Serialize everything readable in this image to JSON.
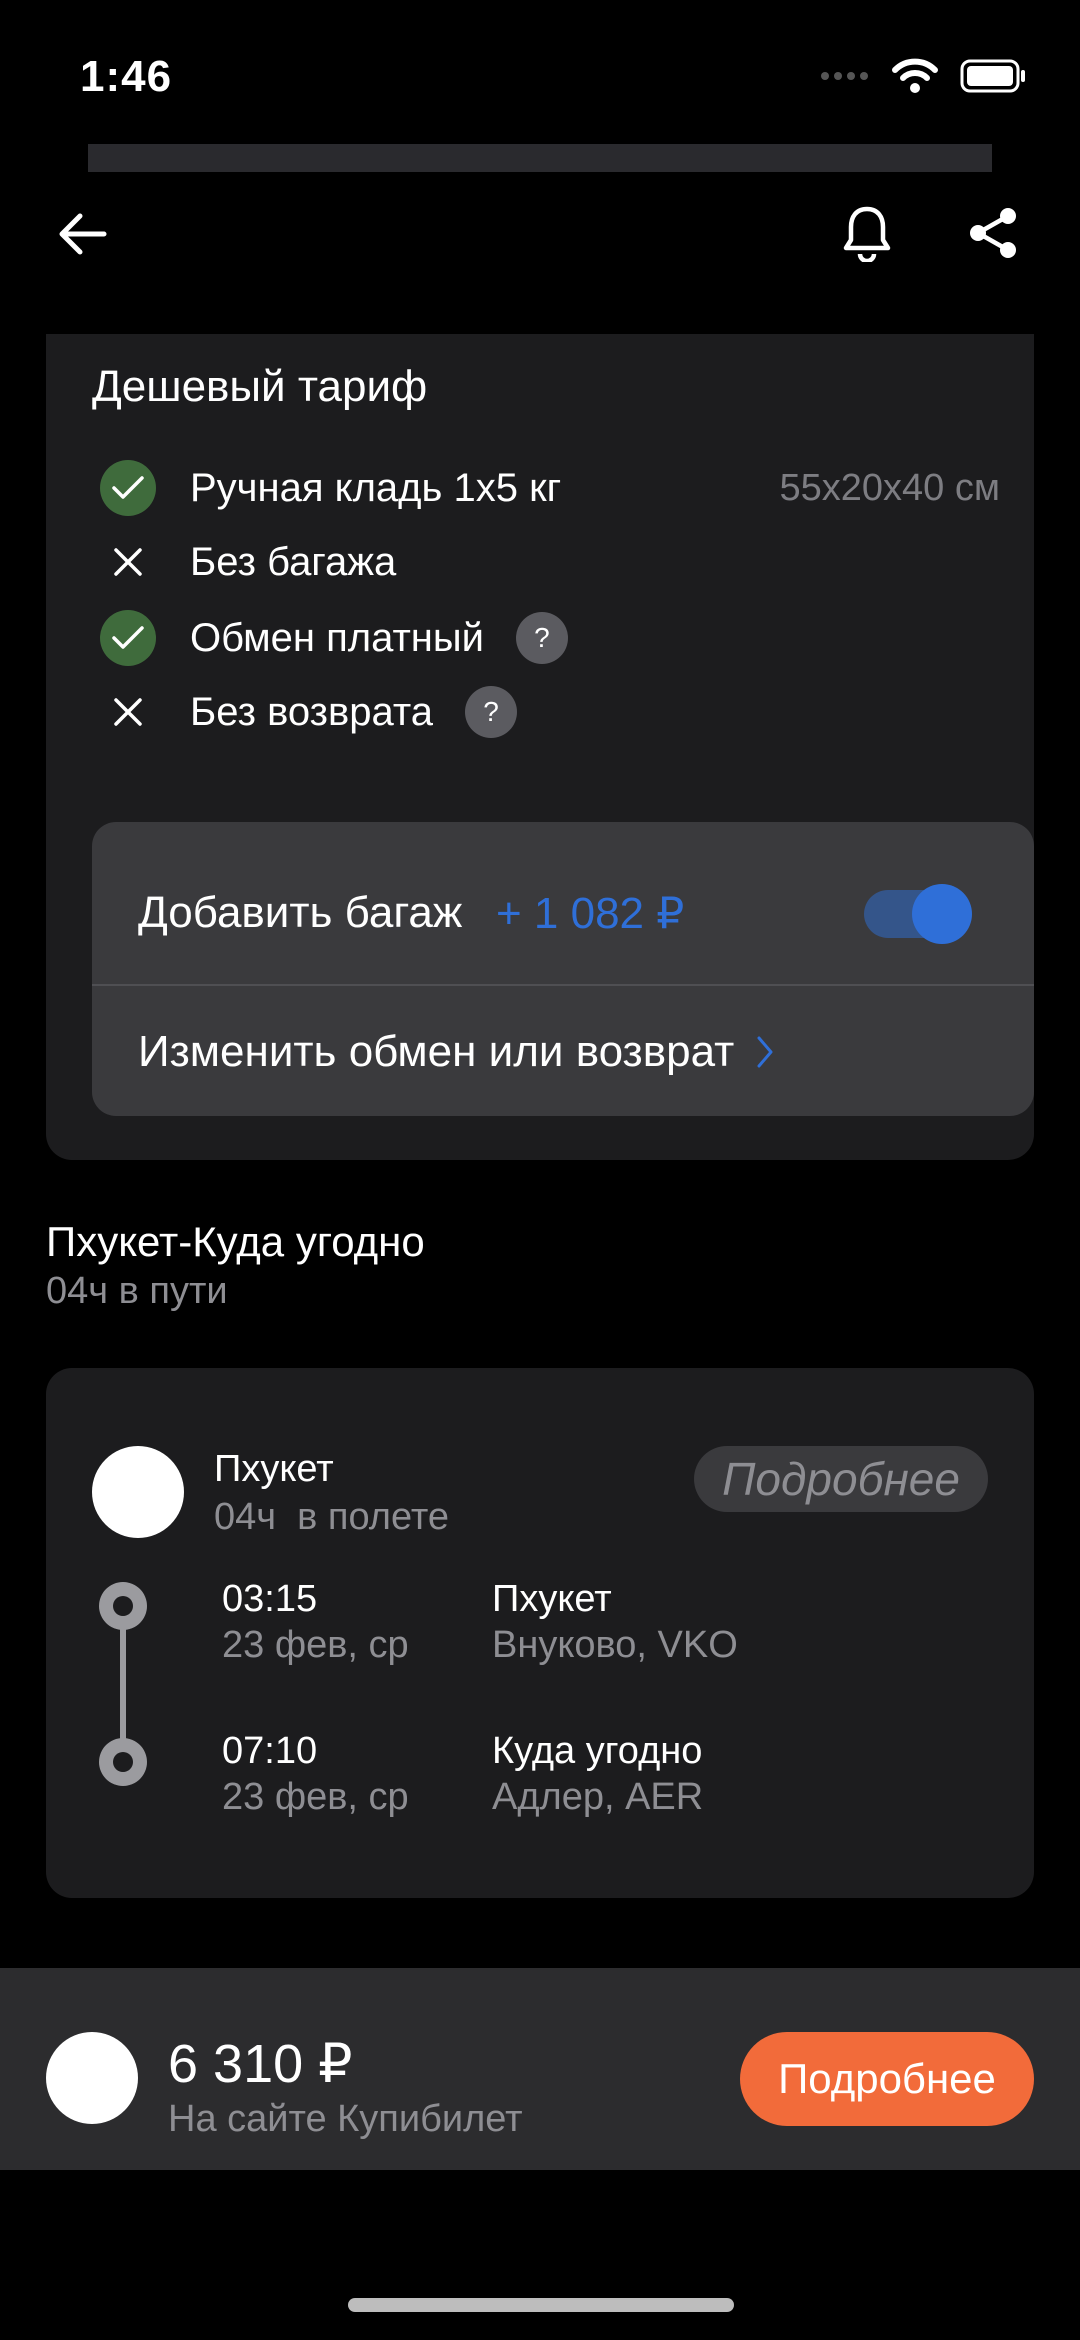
{
  "status_bar": {
    "time": "1:46"
  },
  "tariff": {
    "title": "Дешевый тариф",
    "features": [
      {
        "label": "Ручная кладь 1x5 кг",
        "icon": "check-icon",
        "extra": "55x20x40 см"
      },
      {
        "label": "Без багажа",
        "icon": "cross-icon"
      },
      {
        "label": "Обмен платный",
        "icon": "check-icon",
        "help": "?"
      },
      {
        "label": "Без возврата",
        "icon": "cross-icon",
        "help": "?"
      }
    ],
    "options": {
      "baggage_label": "Добавить багаж",
      "baggage_price": "+ 1 082 ₽",
      "baggage_toggle_on": true,
      "change_label": "Изменить обмен или возврат"
    }
  },
  "route": {
    "title": "Пхукет-Куда угодно",
    "subtitle": "04ч в пути"
  },
  "flight": {
    "airline": "Пхукет",
    "duration": "04ч  в полете",
    "details_label": "Подробнее",
    "segments": [
      {
        "time": "03:15",
        "date": "23 фев, ср",
        "city": "Пхукет",
        "airport": "Внуково, VKO"
      },
      {
        "time": "07:10",
        "date": "23 фев, ср",
        "city": "Куда угодно",
        "airport": "Адлер, AER"
      }
    ]
  },
  "offer": {
    "price": "6 310 ₽",
    "seller": "На сайте Купибилет",
    "button": "Подробнее"
  },
  "colors": {
    "accent_blue": "#2f6fd8",
    "cta_orange": "#f26b3a",
    "check_green": "#3f6b3c"
  }
}
